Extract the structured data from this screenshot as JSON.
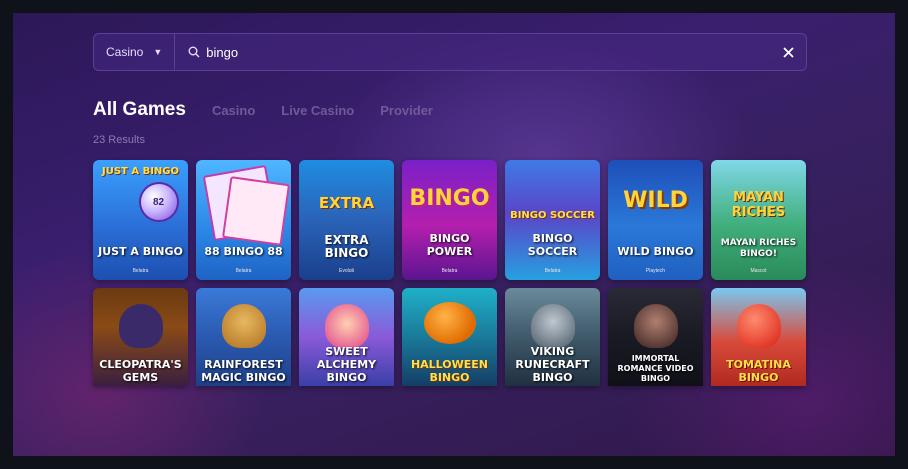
{
  "search": {
    "category": "Casino",
    "query": "bingo",
    "placeholder": ""
  },
  "tabs": {
    "active": "All Games",
    "items": [
      "Casino",
      "Live Casino",
      "Provider"
    ]
  },
  "results_text": "23 Results",
  "colors": {
    "accent": "#7a4fd6",
    "background": "#2c1858",
    "active_tab": "#ffffff",
    "inactive_tab": "#6e5b98"
  },
  "games": [
    {
      "top": "JUST A BINGO",
      "name": "JUST A BINGO",
      "provider": "Belatra",
      "ball": "82"
    },
    {
      "top": "",
      "name": "88 BINGO 88",
      "provider": "Belatra"
    },
    {
      "top": "EXTRA",
      "name": "EXTRA BINGO",
      "provider": "Evoluti"
    },
    {
      "top": "BINGO",
      "name": "BINGO POWER",
      "provider": "Belatra"
    },
    {
      "top": "BINGO SOCCER",
      "name": "BINGO SOCCER",
      "provider": "Belatra"
    },
    {
      "top": "WILD",
      "name": "WILD BINGO",
      "provider": "Playtech"
    },
    {
      "top": "MAYAN RICHES",
      "name": "MAYAN RICHES BINGO!",
      "provider": "Mascot"
    },
    {
      "name": "CLEOPATRA'S GEMS"
    },
    {
      "name": "RAINFOREST MAGIC BINGO"
    },
    {
      "name": "SWEET ALCHEMY BINGO"
    },
    {
      "name": "HALLOWEEN BINGO"
    },
    {
      "name": "VIKING RUNECRAFT BINGO"
    },
    {
      "name": "IMMORTAL ROMANCE VIDEO BINGO"
    },
    {
      "name": "TOMATINA BINGO"
    }
  ]
}
